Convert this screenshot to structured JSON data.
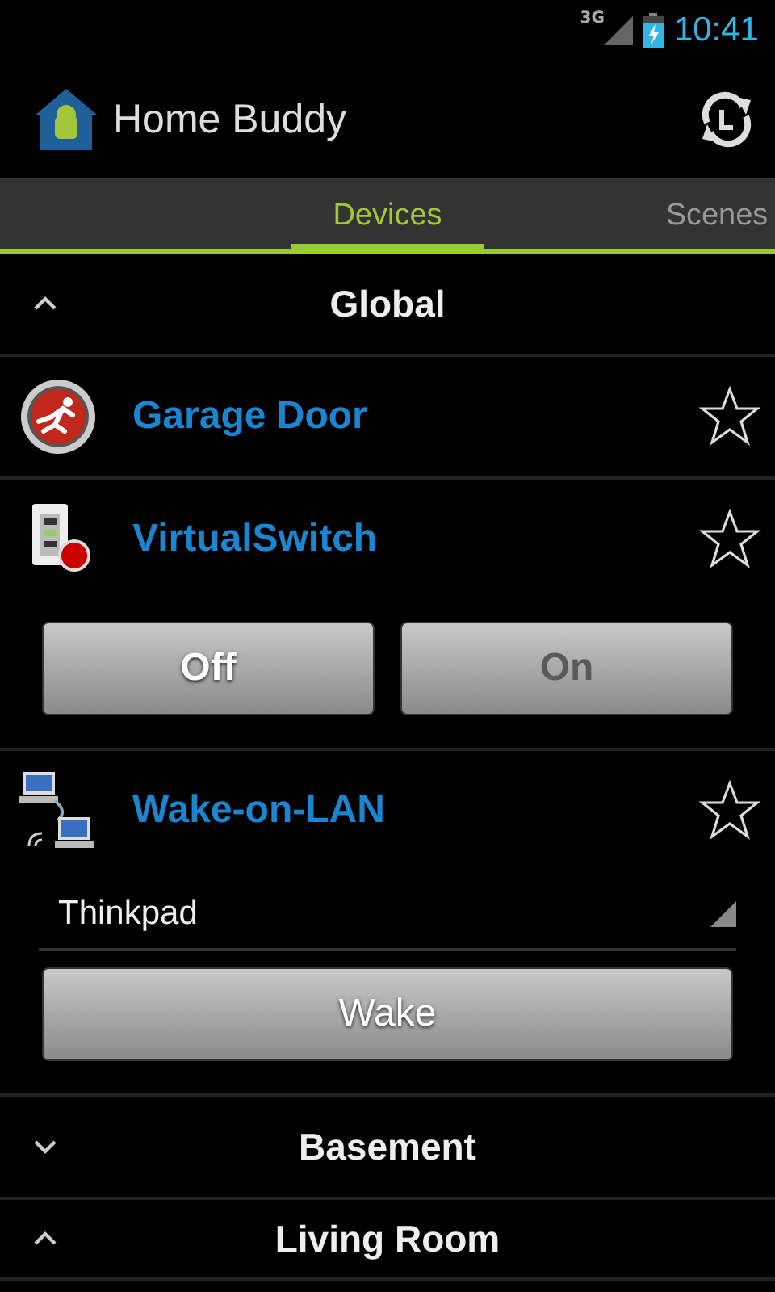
{
  "status_bar": {
    "network": "3G",
    "time": "10:41"
  },
  "action_bar": {
    "title": "Home Buddy"
  },
  "tabs": [
    {
      "label": "Devices",
      "selected": true
    },
    {
      "label": "Scenes",
      "selected": false
    }
  ],
  "groups": [
    {
      "name": "Global",
      "expanded": true,
      "devices": [
        {
          "kind": "plain",
          "name": "Garage Door",
          "starred": false
        },
        {
          "kind": "switch",
          "name": "VirtualSwitch",
          "starred": false,
          "buttons": [
            {
              "label": "Off",
              "disabled": false
            },
            {
              "label": "On",
              "disabled": true
            }
          ]
        },
        {
          "kind": "wol",
          "name": "Wake-on-LAN",
          "starred": false,
          "target": "Thinkpad",
          "action": "Wake"
        }
      ]
    },
    {
      "name": "Basement",
      "expanded": false
    },
    {
      "name": "Living Room",
      "expanded": true
    }
  ]
}
